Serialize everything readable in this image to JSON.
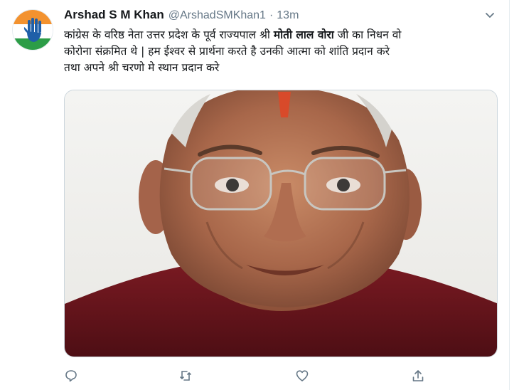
{
  "author": {
    "display_name": "Arshad S M Khan",
    "handle": "@ArshadSMKhan1",
    "separator": "·",
    "time": "13m"
  },
  "tweet": {
    "line1_pre": "कांग्रेस के वरिष्ठ नेता उत्तर प्रदेश के पूर्व राज्यपाल श्री ",
    "line1_bold": "मोती लाल वोरा",
    "line1_post": " जी का निधन वो",
    "line2": "कोरोना संक्रमित थे | हम  ईश्वर से प्रार्थना करते है उनकी आत्मा को शांति प्रदान करे",
    "line3": "तथा अपने श्री चरणो मे स्थान प्रदान करे"
  },
  "icons": {
    "avatar": "congress-hand-logo",
    "caret": "chevron-down-icon",
    "reply": "reply-icon",
    "retweet": "retweet-icon",
    "like": "heart-icon",
    "share": "share-icon"
  },
  "colors": {
    "name": "#14171a",
    "muted": "#657786",
    "saffron": "#f3922f",
    "green": "#2c9d47",
    "accent": "#1da1f2"
  }
}
